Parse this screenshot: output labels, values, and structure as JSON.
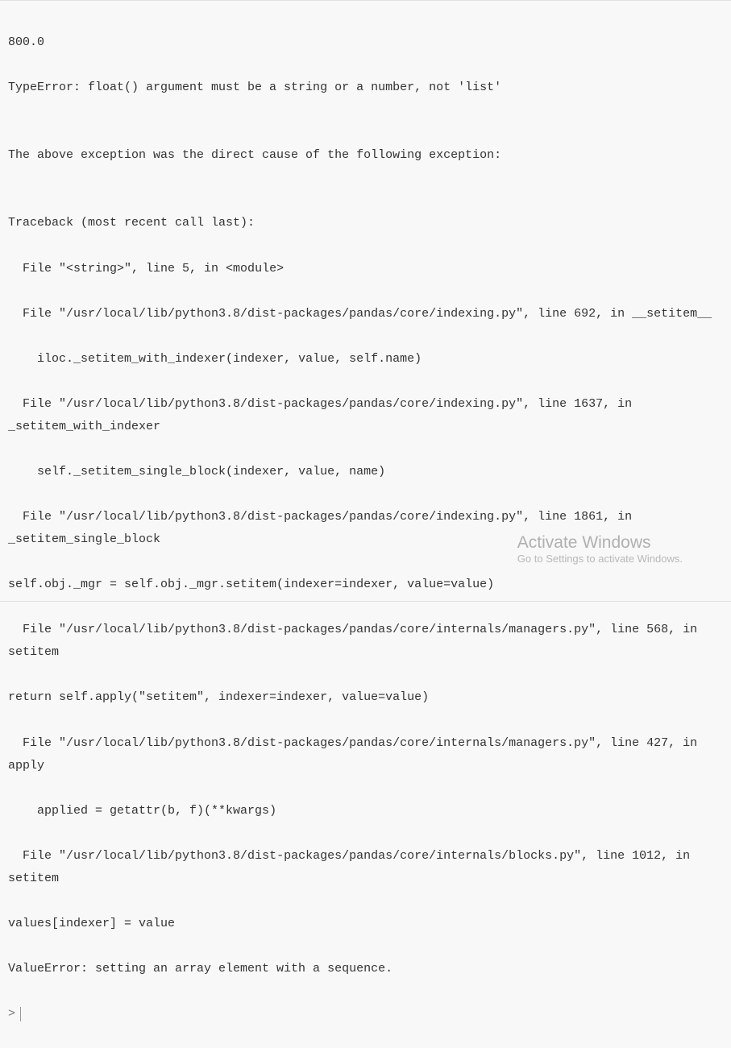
{
  "output": {
    "lines": [
      "800.0",
      "TypeError: float() argument must be a string or a number, not 'list'",
      "",
      "The above exception was the direct cause of the following exception:",
      "",
      "Traceback (most recent call last):",
      "  File \"<string>\", line 5, in <module>",
      "  File \"/usr/local/lib/python3.8/dist-packages/pandas/core/indexing.py\", line 692, in __setitem__",
      "    iloc._setitem_with_indexer(indexer, value, self.name)",
      "  File \"/usr/local/lib/python3.8/dist-packages/pandas/core/indexing.py\", line 1637, in _setitem_with_indexer",
      "    self._setitem_single_block(indexer, value, name)",
      "  File \"/usr/local/lib/python3.8/dist-packages/pandas/core/indexing.py\", line 1861, in _setitem_single_block",
      "self.obj._mgr = self.obj._mgr.setitem(indexer=indexer, value=value)",
      "  File \"/usr/local/lib/python3.8/dist-packages/pandas/core/internals/managers.py\", line 568, in setitem",
      "return self.apply(\"setitem\", indexer=indexer, value=value)",
      "  File \"/usr/local/lib/python3.8/dist-packages/pandas/core/internals/managers.py\", line 427, in apply",
      "    applied = getattr(b, f)(**kwargs)",
      "  File \"/usr/local/lib/python3.8/dist-packages/pandas/core/internals/blocks.py\", line 1012, in setitem",
      "values[indexer] = value",
      "ValueError: setting an array element with a sequence."
    ]
  },
  "prompt": {
    "symbol": ">"
  },
  "watermark": {
    "title": "Activate Windows",
    "subtitle": "Go to Settings to activate Windows."
  }
}
